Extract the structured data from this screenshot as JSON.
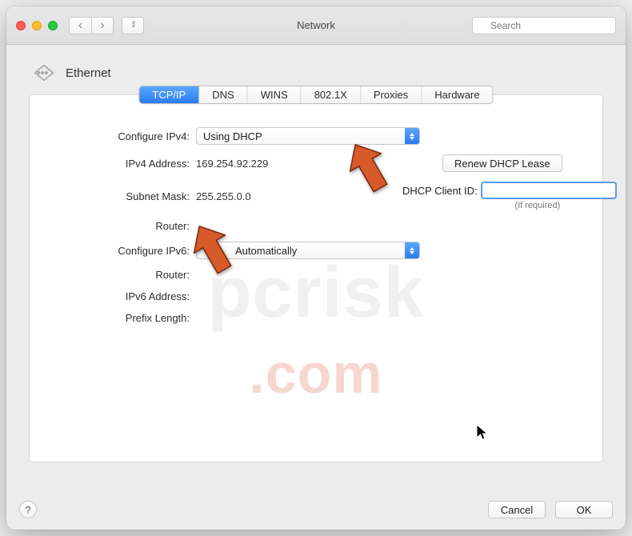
{
  "window": {
    "title": "Network"
  },
  "search": {
    "placeholder": "Search",
    "value": ""
  },
  "header": {
    "title": "Ethernet"
  },
  "tabs": [
    {
      "label": "TCP/IP",
      "selected": true
    },
    {
      "label": "DNS",
      "selected": false
    },
    {
      "label": "WINS",
      "selected": false
    },
    {
      "label": "802.1X",
      "selected": false
    },
    {
      "label": "Proxies",
      "selected": false
    },
    {
      "label": "Hardware",
      "selected": false
    }
  ],
  "form": {
    "configure_ipv4_label": "Configure IPv4:",
    "configure_ipv4_value": "Using DHCP",
    "ipv4_address_label": "IPv4 Address:",
    "ipv4_address_value": "169.254.92.229",
    "subnet_mask_label": "Subnet Mask:",
    "subnet_mask_value": "255.255.0.0",
    "router_label": "Router:",
    "router_value": "",
    "configure_ipv6_label": "Configure IPv6:",
    "configure_ipv6_value": "Automatically",
    "router6_label": "Router:",
    "router6_value": "",
    "ipv6_address_label": "IPv6 Address:",
    "ipv6_address_value": "",
    "prefix_length_label": "Prefix Length:",
    "prefix_length_value": "",
    "renew_dhcp_lease": "Renew DHCP Lease",
    "dhcp_client_id_label": "DHCP Client ID:",
    "dhcp_client_id_value": "",
    "dhcp_client_id_hint": "(If required)"
  },
  "buttons": {
    "help": "?",
    "cancel": "Cancel",
    "ok": "OK"
  },
  "icons": {
    "back": "‹",
    "forward": "›",
    "grid": "⋮⋮⋮",
    "search": "magnifying-glass",
    "ethernet": "ethernet-diamond"
  },
  "watermark": {
    "line1": "pcrisk",
    "line2": ".com"
  },
  "colors": {
    "accent": "#2a7bf0",
    "arrow": "#d85a2a"
  }
}
